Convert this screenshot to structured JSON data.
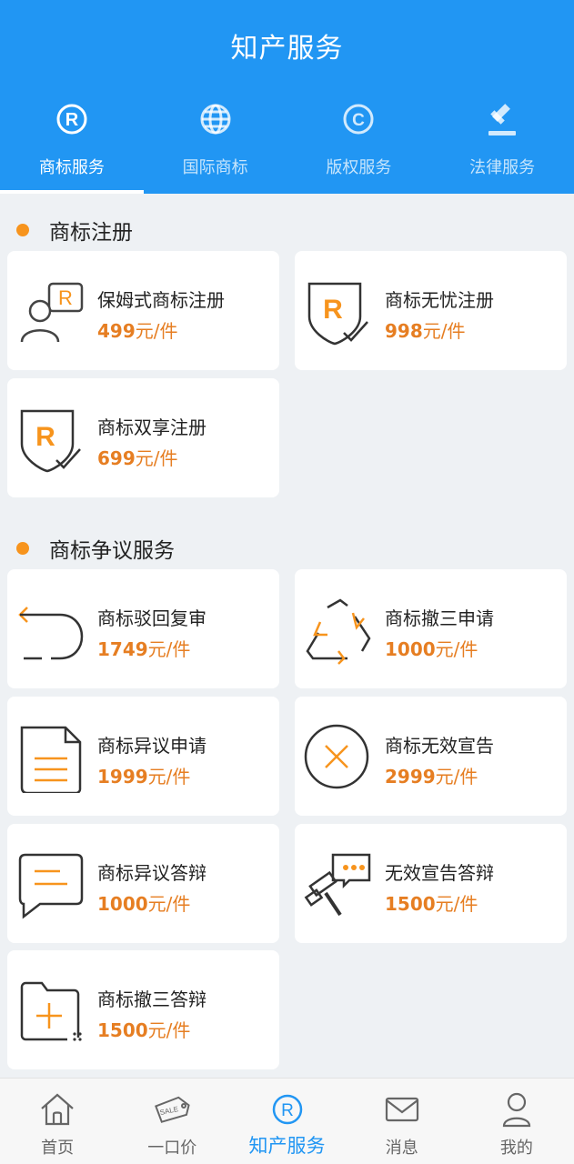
{
  "header": {
    "title": "知产服务"
  },
  "tabs": [
    {
      "label": "商标服务",
      "icon": "registered-icon",
      "active": true
    },
    {
      "label": "国际商标",
      "icon": "globe-icon",
      "active": false
    },
    {
      "label": "版权服务",
      "icon": "copyright-icon",
      "active": false
    },
    {
      "label": "法律服务",
      "icon": "gavel-icon",
      "active": false
    }
  ],
  "sections": [
    {
      "title": "商标注册",
      "cards": [
        {
          "name": "保姆式商标注册",
          "price": "499",
          "unit": "元/件",
          "icon": "person-r-icon"
        },
        {
          "name": "商标无忧注册",
          "price": "998",
          "unit": "元/件",
          "icon": "shield-r-icon"
        },
        {
          "name": "商标双享注册",
          "price": "699",
          "unit": "元/件",
          "icon": "shield-r-icon"
        }
      ]
    },
    {
      "title": "商标争议服务",
      "cards": [
        {
          "name": "商标驳回复审",
          "price": "1749",
          "unit": "元/件",
          "icon": "return-arrow-icon"
        },
        {
          "name": "商标撤三申请",
          "price": "1000",
          "unit": "元/件",
          "icon": "recycle-icon"
        },
        {
          "name": "商标异议申请",
          "price": "1999",
          "unit": "元/件",
          "icon": "document-icon"
        },
        {
          "name": "商标无效宣告",
          "price": "2999",
          "unit": "元/件",
          "icon": "cancel-circle-icon"
        },
        {
          "name": "商标异议答辩",
          "price": "1000",
          "unit": "元/件",
          "icon": "chat-bubble-icon"
        },
        {
          "name": "无效宣告答辩",
          "price": "1500",
          "unit": "元/件",
          "icon": "gavel-chat-icon"
        },
        {
          "name": "商标撤三答辩",
          "price": "1500",
          "unit": "元/件",
          "icon": "folder-plus-icon"
        }
      ]
    }
  ],
  "bottom_nav": [
    {
      "label": "首页",
      "icon": "home-icon",
      "active": false
    },
    {
      "label": "一口价",
      "icon": "sale-tag-icon",
      "active": false
    },
    {
      "label": "知产服务",
      "icon": "registered-icon",
      "active": true
    },
    {
      "label": "消息",
      "icon": "mail-icon",
      "active": false
    },
    {
      "label": "我的",
      "icon": "user-icon",
      "active": false
    }
  ],
  "colors": {
    "primary": "#2196f3",
    "accent": "#f7941d",
    "price": "#e67e22",
    "background": "#eef1f4"
  }
}
